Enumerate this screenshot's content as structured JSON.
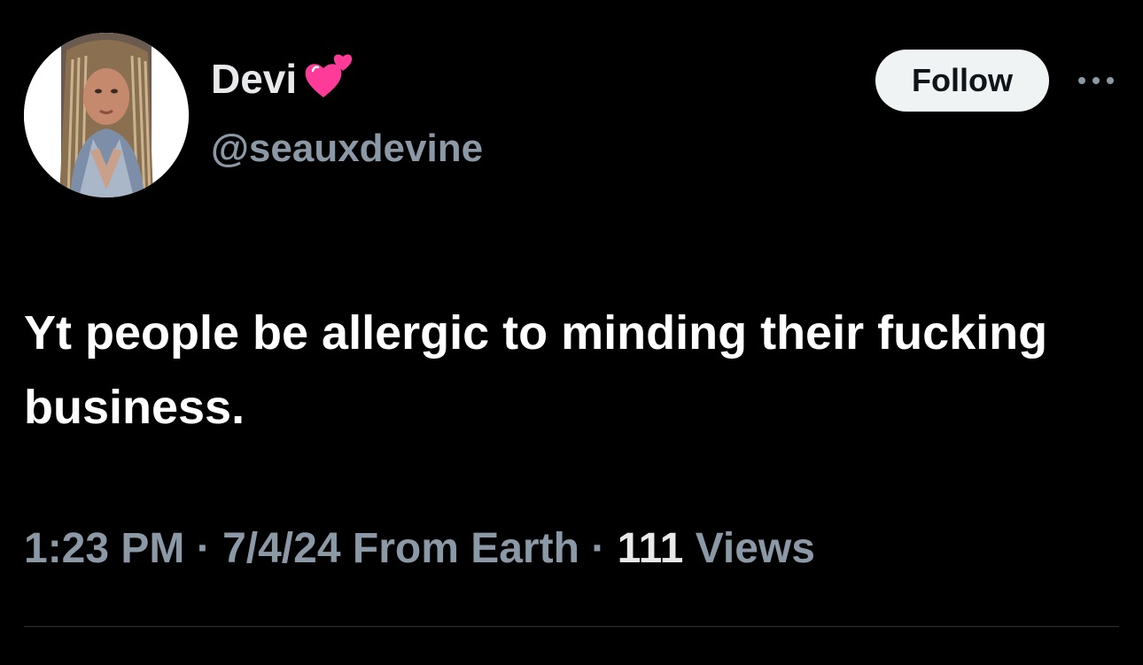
{
  "author": {
    "display_name": "Devi",
    "name_emoji_icon": "two-hearts-icon",
    "handle": "@seauxdevine",
    "avatar_icon": "profile-photo"
  },
  "actions": {
    "follow_label": "Follow",
    "more_icon": "more-horizontal-icon"
  },
  "tweet": {
    "text": "Yt people be allergic to minding their fucking business."
  },
  "meta": {
    "time": "1:23 PM",
    "separator": "·",
    "date": "7/4/24",
    "source": "From Earth",
    "views_count": "111",
    "views_label": "Views"
  },
  "colors": {
    "background": "#000000",
    "primary_text": "#e7e9ea",
    "secondary_text": "#8b98a5",
    "follow_button_bg": "#eff3f4",
    "follow_button_text": "#0f1419",
    "divider": "#2f3336",
    "heart": "#ff3b9a"
  }
}
